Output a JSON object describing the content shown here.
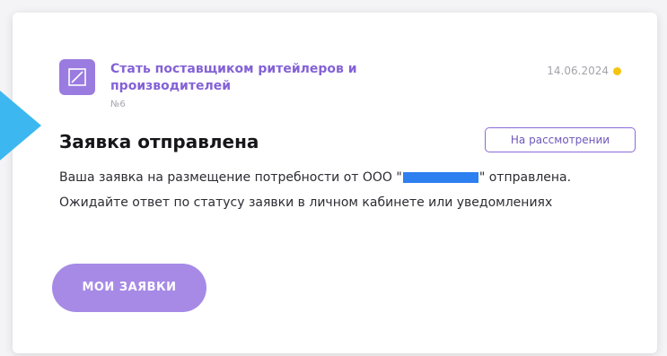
{
  "card": {
    "service_title": "Стать поставщиком ритейлеров и производителей",
    "service_number": "№6",
    "date": "14.06.2024",
    "status_color": "#f5c40e",
    "heading": "Заявка отправлена",
    "status_badge": "На рассмотрении",
    "message_part1": "Ваша заявка на размещение потребности от ООО \"",
    "message_part2": "\" отправлена. Ожидайте ответ по статусу заявки в личном кабинете или уведомлениях",
    "button_label": "МОИ ЗАЯВКИ"
  },
  "colors": {
    "accent": "#8462d6",
    "button": "#a68ae6",
    "pointer": "#3db7ef"
  }
}
